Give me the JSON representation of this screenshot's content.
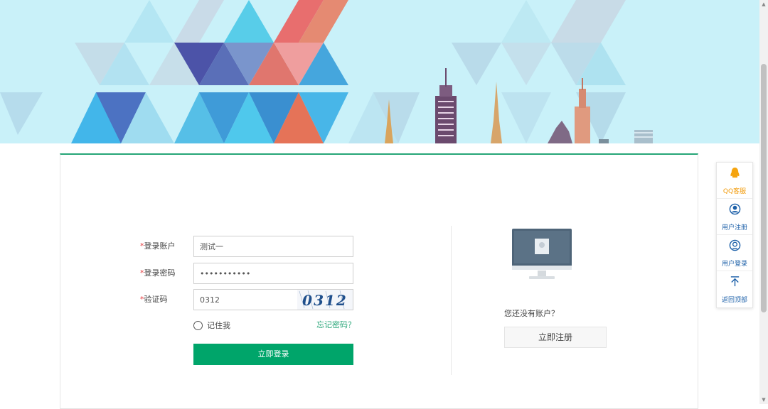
{
  "banner": {
    "alt": ""
  },
  "login_form": {
    "account_label": "登录账户",
    "password_label": "登录密码",
    "captcha_label": "验证码",
    "required_mark": "*",
    "account_value": "测试一",
    "password_value": "•••••••••••",
    "captcha_value": "0312",
    "captcha_image_text": "0312",
    "remember_label": "记住我",
    "forgot_link": "忘记密码？",
    "login_button": "立即登录"
  },
  "register": {
    "prompt": "您还没有账户？",
    "button": "立即注册"
  },
  "side_toolbar": {
    "items": [
      {
        "label": "QQ客服",
        "icon": "qq-penguin-icon"
      },
      {
        "label": "用户注册",
        "icon": "user-icon"
      },
      {
        "label": "用户登录",
        "icon": "login-user-icon"
      },
      {
        "label": "返回顶部",
        "icon": "arrow-up-icon"
      }
    ]
  },
  "colors": {
    "accent_green": "#00a56a",
    "link_green": "#26a577",
    "required_red": "#e4393c",
    "qq_orange": "#f29b0b",
    "sidebar_blue": "#1b5fa8",
    "banner_bg": "#c9f1f9"
  }
}
